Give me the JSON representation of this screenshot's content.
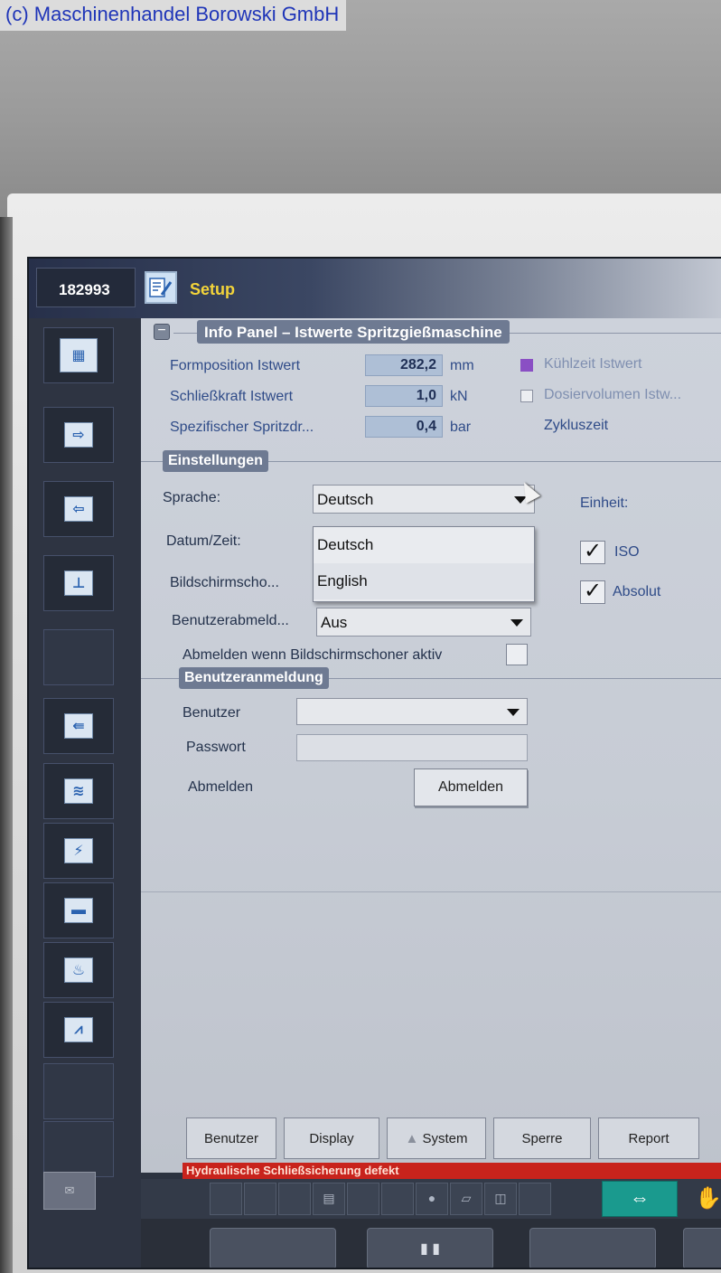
{
  "watermark": "(c) Maschinenhandel Borowski GmbH",
  "title_bar": {
    "machine_id": "182993",
    "title": "Setup"
  },
  "info_panel": {
    "title": "Info Panel – Istwerte Spritzgießmaschine",
    "rows": [
      {
        "label": "Formposition Istwert",
        "value": "282,2",
        "unit": "mm"
      },
      {
        "label": "Schließkraft Istwert",
        "value": "1,0",
        "unit": "kN"
      },
      {
        "label": "Spezifischer Spritzdr...",
        "value": "0,4",
        "unit": "bar"
      }
    ],
    "legend": [
      {
        "label": "Kühlzeit Istwert",
        "color": "#8a4fc4"
      },
      {
        "label": "Dosiervolumen Istw...",
        "color": "#eceef2"
      },
      {
        "label": "Zykluszeit",
        "color": ""
      }
    ]
  },
  "settings": {
    "title": "Einstellungen",
    "sprache_label": "Sprache:",
    "sprache_value": "Deutsch",
    "sprache_options": [
      "Deutsch",
      "English"
    ],
    "datum_label": "Datum/Zeit:",
    "bildschirm_label": "Bildschirmscho...",
    "benutzerabmeld_label": "Benutzerabmeld...",
    "benutzerabmeld_value": "Aus",
    "abmelden_schoner_label": "Abmelden wenn Bildschirmschoner aktiv",
    "einheit_label": "Einheit:",
    "iso_label": "ISO",
    "absolut_label": "Absolut"
  },
  "login": {
    "title": "Benutzeranmeldung",
    "benutzer_label": "Benutzer",
    "benutzer_value": "",
    "passwort_label": "Passwort",
    "abmelden_label": "Abmelden",
    "abmelden_button": "Abmelden"
  },
  "tabs": [
    "Benutzer",
    "Display",
    "System",
    "Sperre",
    "Report"
  ],
  "status_message": "Hydraulische Schließsicherung  defekt",
  "colors": {
    "accent_title": "#f3d43a",
    "status_red": "#c8231c",
    "highlight_teal": "#1a9a8e"
  }
}
